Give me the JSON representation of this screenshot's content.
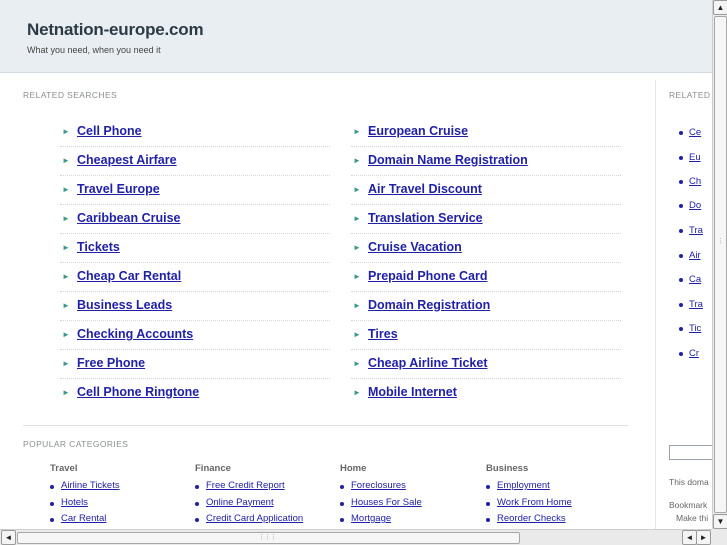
{
  "header": {
    "title": "Netnation-europe.com",
    "tagline": "What you need, when you need it"
  },
  "related": {
    "label": "RELATED SEARCHES",
    "left": [
      "Cell Phone",
      "Cheapest Airfare",
      "Travel Europe",
      "Caribbean Cruise",
      "Tickets",
      "Cheap Car Rental",
      "Business Leads",
      "Checking Accounts",
      "Free Phone",
      "Cell Phone Ringtone"
    ],
    "right": [
      "European Cruise",
      "Domain Name Registration",
      "Air Travel Discount",
      "Translation Service",
      "Cruise Vacation",
      "Prepaid Phone Card",
      "Domain Registration",
      "Tires",
      "Cheap Airline Ticket",
      "Mobile Internet"
    ]
  },
  "popular": {
    "label": "POPULAR CATEGORIES",
    "categories": [
      {
        "title": "Travel",
        "links": [
          "Airline Tickets",
          "Hotels",
          "Car Rental"
        ]
      },
      {
        "title": "Finance",
        "links": [
          "Free Credit Report",
          "Online Payment",
          "Credit Card Application"
        ]
      },
      {
        "title": "Home",
        "links": [
          "Foreclosures",
          "Houses For Sale",
          "Mortgage"
        ]
      },
      {
        "title": "Business",
        "links": [
          "Employment",
          "Work From Home",
          "Reorder Checks"
        ]
      }
    ]
  },
  "sidebar": {
    "label": "RELATED",
    "items": [
      "Ce",
      "Eu",
      "Ch",
      "Do",
      "Tra",
      "Air",
      "Ca",
      "Tra",
      "Tic",
      "Cr"
    ],
    "text1": "This doma",
    "text2": "Bookmark",
    "text3": "Make thi"
  },
  "icons": {
    "arrow": "►",
    "scroll_up": "▲",
    "scroll_down": "▼",
    "scroll_left": "◄",
    "scroll_right": "►",
    "grip": "⋮⋮⋮"
  }
}
